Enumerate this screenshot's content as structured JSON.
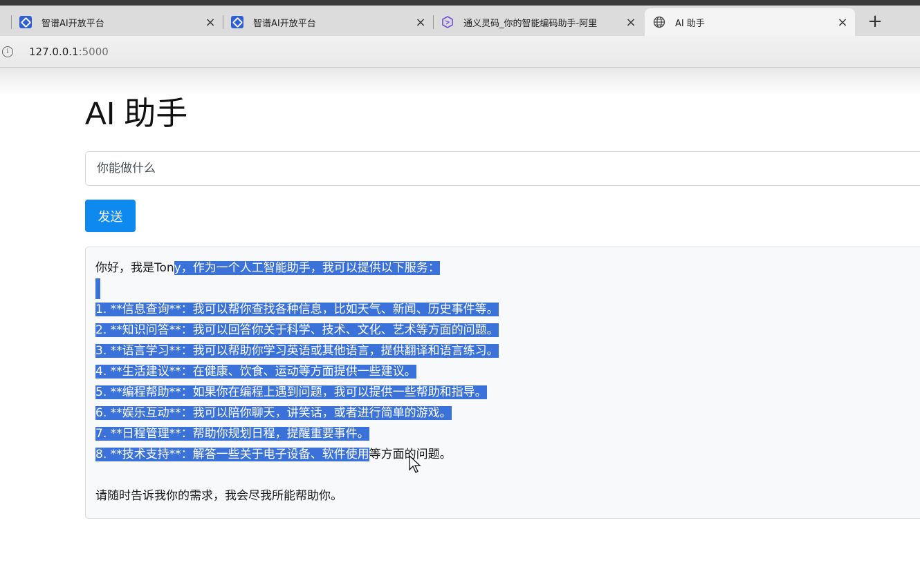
{
  "browser": {
    "tabs": [
      {
        "title": "智谱AI开放平台",
        "favicon": "zhipu-icon",
        "active": false
      },
      {
        "title": "智谱AI开放平台",
        "favicon": "zhipu-icon",
        "active": false
      },
      {
        "title": "通义灵码_你的智能编码助手-阿里",
        "favicon": "tongyi-icon",
        "active": false
      },
      {
        "title": "AI 助手",
        "favicon": "globe-icon",
        "active": true
      }
    ],
    "close_glyph": "×",
    "new_tab_glyph": "+",
    "info_glyph": "i",
    "url_host": "127.0.0.1",
    "url_port": ":5000"
  },
  "page": {
    "title": "AI 助手",
    "input_placeholder": "你能做什么",
    "send_label": "发送"
  },
  "response": {
    "greeting_pre": "你好，我是Ton",
    "greeting_sel": "y，作为一个人工智能助手，我可以提供以下服务：",
    "items": [
      "1. **信息查询**：我可以帮你查找各种信息，比如天气、新闻、历史事件等。",
      "2. **知识问答**：我可以回答你关于科学、技术、文化、艺术等方面的问题。",
      "3. **语言学习**：我可以帮助你学习英语或其他语言，提供翻译和语言练习。",
      "4. **生活建议**：在健康、饮食、运动等方面提供一些建议。",
      "5. **编程帮助**：如果你在编程上遇到问题，我可以提供一些帮助和指导。",
      "6. **娱乐互动**：我可以陪你聊天，讲笑话，或者进行简单的游戏。",
      "7. **日程管理**：帮助你规划日程，提醒重要事件。"
    ],
    "last_item_sel": "8. **技术支持**：解答一些关于电子设备、软件使用",
    "last_item_rest": "等方面的问题。",
    "closing": "请随时告诉我你的需求，我会尽我所能帮助你。"
  },
  "colors": {
    "send_button": "#0d89f0",
    "selection": "#3b72d9"
  }
}
